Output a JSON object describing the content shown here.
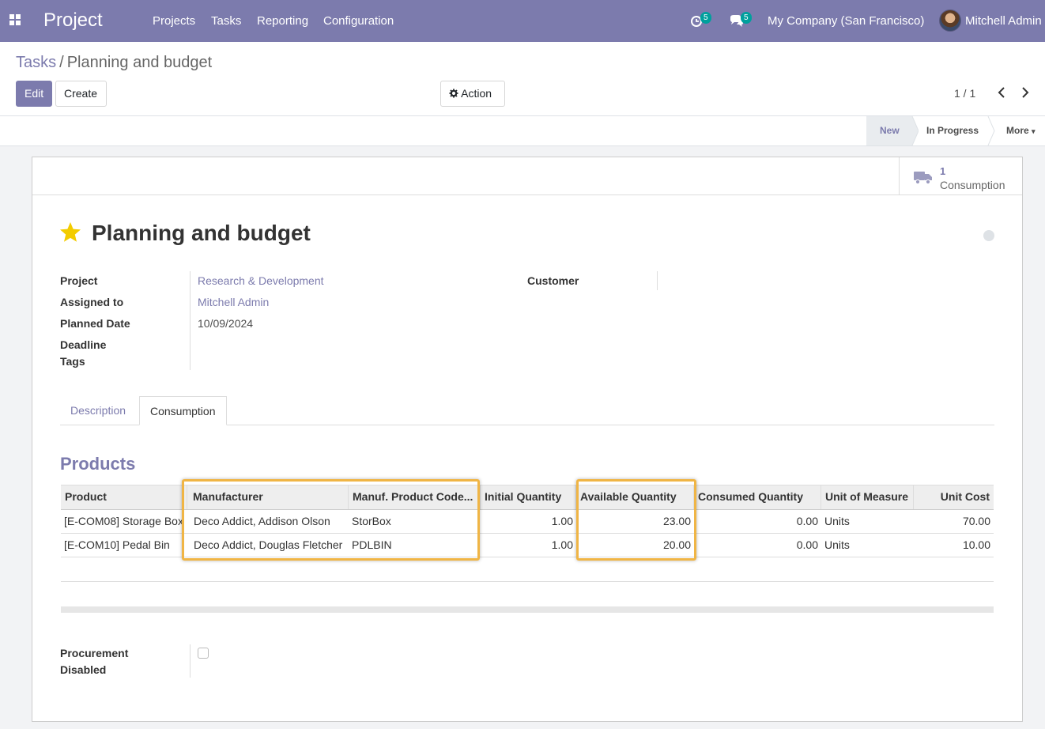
{
  "nav": {
    "app_name": "Project",
    "menu": [
      "Projects",
      "Tasks",
      "Reporting",
      "Configuration"
    ],
    "activity_count": "5",
    "message_count": "5",
    "company": "My Company (San Francisco)",
    "user": "Mitchell Admin"
  },
  "control": {
    "breadcrumb_parent": "Tasks",
    "breadcrumb_separator": "/",
    "breadcrumb_current": "Planning and budget",
    "edit_label": "Edit",
    "create_label": "Create",
    "action_label": "Action",
    "pager": "1 / 1"
  },
  "stages": {
    "new": "New",
    "in_progress": "In Progress",
    "more": "More"
  },
  "smart_button": {
    "count": "1",
    "label": "Consumption"
  },
  "task": {
    "title": "Planning and budget",
    "fields": {
      "project_label": "Project",
      "project_value": "Research & Development",
      "assigned_label": "Assigned to",
      "assigned_value": "Mitchell Admin",
      "planned_label": "Planned Date",
      "planned_value": "10/09/2024",
      "deadline_label": "Deadline",
      "tags_label": "Tags",
      "customer_label": "Customer"
    }
  },
  "tabs": [
    "Description",
    "Consumption"
  ],
  "products": {
    "section_title": "Products",
    "columns": [
      "Product",
      "Manufacturer",
      "Manuf. Product Code...",
      "Initial Quantity",
      "Available Quantity",
      "Consumed Quantity",
      "Unit of Measure",
      "Unit Cost"
    ],
    "rows": [
      {
        "product": "[E-COM08] Storage Box",
        "manufacturer": "Deco Addict, Addison Olson",
        "code": "StorBox",
        "initial": "1.00",
        "available": "23.00",
        "consumed": "0.00",
        "uom": "Units",
        "cost": "70.00"
      },
      {
        "product": "[E-COM10] Pedal Bin",
        "manufacturer": "Deco Addict, Douglas Fletcher",
        "code": "PDLBIN",
        "initial": "1.00",
        "available": "20.00",
        "consumed": "0.00",
        "uom": "Units",
        "cost": "10.00"
      }
    ]
  },
  "procurement": {
    "label_line1": "Procurement",
    "label_line2": "Disabled",
    "checked": false
  },
  "colors": {
    "brand": "#7c7bad",
    "badge": "#00a09d",
    "highlight": "#f0b545",
    "star": "#f3cc00"
  }
}
